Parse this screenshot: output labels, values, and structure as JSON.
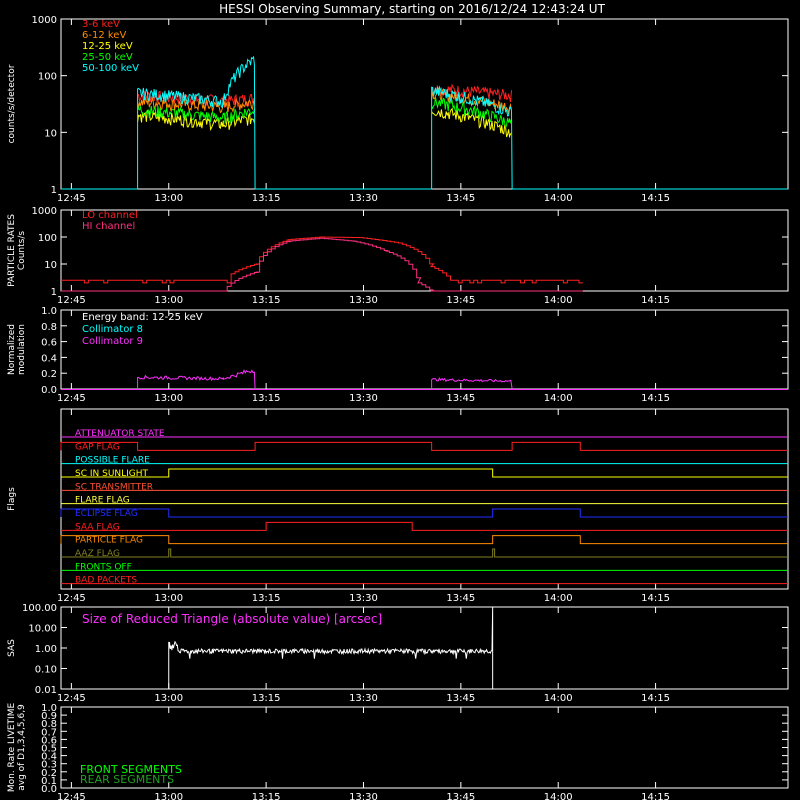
{
  "title": "HESSI Observing Summary, starting on 2016/12/24 12:43:24 UT",
  "time_ticks": [
    "12:45",
    "13:00",
    "13:15",
    "13:30",
    "13:45",
    "14:00",
    "14:15"
  ],
  "colors": {
    "3-6": "#ff2020",
    "6-12": "#ff8c00",
    "12-25": "#ffff00",
    "25-50": "#00ff00",
    "50-100": "#00ffff",
    "lo": "#ff2020",
    "hi": "#ff3080",
    "white": "#ffffff",
    "magenta": "#ff30ff"
  },
  "chart_data": [
    {
      "type": "line",
      "ylabel": "counts/s/detector",
      "ylim": [
        1,
        1000
      ],
      "yscale": "log",
      "yticks": [
        "1",
        "10",
        "100",
        "1000"
      ],
      "x_unit": "minutes from 12:43:24",
      "series": [
        {
          "name": "3-6 keV",
          "color": "#ff2020",
          "segments": [
            [
              [
                11.8,
                45
              ],
              [
                25,
                36
              ],
              [
                29.9,
                40
              ]
            ],
            [
              [
                57.1,
                60
              ],
              [
                69.5,
                45
              ]
            ]
          ]
        },
        {
          "name": "6-12 keV",
          "color": "#ff8c00",
          "segments": [
            [
              [
                11.8,
                35
              ],
              [
                25,
                28
              ],
              [
                29.9,
                35
              ]
            ],
            [
              [
                57.1,
                50
              ],
              [
                69.5,
                27
              ]
            ]
          ]
        },
        {
          "name": "12-25 keV",
          "color": "#ffff00",
          "segments": [
            [
              [
                11.8,
                20
              ],
              [
                25,
                14
              ],
              [
                29.9,
                18
              ]
            ],
            [
              [
                57.1,
                25
              ],
              [
                69.5,
                10
              ]
            ]
          ]
        },
        {
          "name": "25-50 keV",
          "color": "#00ff00",
          "segments": [
            [
              [
                11.8,
                25
              ],
              [
                25,
                18
              ],
              [
                29.9,
                25
              ]
            ],
            [
              [
                57.1,
                35
              ],
              [
                69.5,
                14
              ]
            ]
          ]
        },
        {
          "name": "50-100 keV",
          "color": "#00ffff",
          "segments": [
            [
              [
                11.8,
                50
              ],
              [
                25,
                35
              ],
              [
                29.9,
                200
              ]
            ],
            [
              [
                57.1,
                55
              ],
              [
                69.5,
                22
              ]
            ]
          ]
        }
      ]
    },
    {
      "type": "line",
      "ylabel": "PARTICLE RATES\nCounts/s",
      "ylim": [
        1,
        1000
      ],
      "yscale": "log",
      "yticks": [
        "1",
        "10",
        "100",
        "1000"
      ],
      "series": [
        {
          "name": "LO channel",
          "color": "#ff2020",
          "points": [
            [
              0,
              2.5
            ],
            [
              25,
              2.5
            ],
            [
              30,
              10
            ],
            [
              35,
              80
            ],
            [
              40,
              100
            ],
            [
              46,
              95
            ],
            [
              52,
              60
            ],
            [
              57,
              8
            ],
            [
              60,
              2.5
            ],
            [
              80,
              2.5
            ]
          ]
        },
        {
          "name": "HI channel",
          "color": "#ff3080",
          "points": [
            [
              0,
              1
            ],
            [
              25,
              1
            ],
            [
              30,
              5
            ],
            [
              35,
              70
            ],
            [
              40,
              90
            ],
            [
              45,
              70
            ],
            [
              50,
              30
            ],
            [
              55,
              2
            ],
            [
              57,
              1
            ],
            [
              80,
              1
            ]
          ]
        }
      ]
    },
    {
      "type": "line",
      "ylabel": "Normalized\nmodulation",
      "ylim": [
        0,
        1
      ],
      "yticks": [
        "0.0",
        "0.2",
        "0.4",
        "0.6",
        "0.8",
        "1.0"
      ],
      "annotation": "Energy band: 12-25 keV",
      "series": [
        {
          "name": "Collimator 8",
          "color": "#00ffff",
          "points": []
        },
        {
          "name": "Collimator 9",
          "color": "#ff30ff",
          "segments": [
            [
              [
                11.8,
                0.15
              ],
              [
                25,
                0.13
              ],
              [
                29.9,
                0.25
              ]
            ],
            [
              [
                57.1,
                0.12
              ],
              [
                69.5,
                0.1
              ]
            ]
          ]
        }
      ]
    },
    {
      "type": "line",
      "ylabel": "Flags",
      "flags": [
        {
          "name": "ATTENUATOR STATE",
          "color": "#ff30ff",
          "on_intervals": []
        },
        {
          "name": "GAP FLAG",
          "color": "#ff2020",
          "on_intervals": [
            [
              0,
              11.8
            ],
            [
              29.9,
              57.1
            ],
            [
              69.5,
              80
            ]
          ]
        },
        {
          "name": "POSSIBLE FLARE",
          "color": "#00ffff",
          "on_intervals": []
        },
        {
          "name": "SC IN SUNLIGHT",
          "color": "#ffff00",
          "on_intervals": [
            [
              16.6,
              66.5
            ]
          ]
        },
        {
          "name": "SC TRANSMITTER",
          "color": "#ff5030",
          "on_intervals": []
        },
        {
          "name": "FLARE FLAG",
          "color": "#ffff40",
          "on_intervals": []
        },
        {
          "name": "ECLIPSE FLAG",
          "color": "#2030ff",
          "on_intervals": [
            [
              0,
              16.6
            ],
            [
              66.5,
              80
            ]
          ]
        },
        {
          "name": "SAA FLAG",
          "color": "#ff2020",
          "on_intervals": [
            [
              31.6,
              54.1
            ]
          ]
        },
        {
          "name": "PARTICLE FLAG",
          "color": "#ff8c00",
          "on_intervals": [
            [
              0,
              16.6
            ],
            [
              66.5,
              80
            ]
          ]
        },
        {
          "name": "AAZ FLAG",
          "color": "#808020",
          "on_intervals": [
            [
              16.6,
              16.9
            ],
            [
              66.5,
              66.8
            ]
          ]
        },
        {
          "name": "FRONTS OFF",
          "color": "#00ff00",
          "on_intervals": []
        },
        {
          "name": "BAD PACKETS",
          "color": "#ff2020",
          "on_intervals": []
        }
      ]
    },
    {
      "type": "line",
      "ylabel": "SAS",
      "ylim": [
        0.01,
        100
      ],
      "yscale": "log",
      "yticks": [
        "0.01",
        "0.10",
        "1.00",
        "10.00",
        "100.00"
      ],
      "annotation": "Size of Reduced Triangle (absolute value) [arcsec]",
      "series": [
        {
          "name": "Size of Reduced Triangle",
          "color": "#ffffff",
          "points": [
            [
              16.6,
              0.8
            ],
            [
              20,
              0.65
            ],
            [
              40,
              0.7
            ],
            [
              66.5,
              0.75
            ]
          ]
        }
      ]
    },
    {
      "type": "line",
      "ylabel": "Mon. Rate LIVETIME\navg of D1,3,4,5,6,9",
      "ylim": [
        0,
        1
      ],
      "yticks": [
        "0.0",
        "0.1",
        "0.2",
        "0.3",
        "0.4",
        "0.5",
        "0.6",
        "0.7",
        "0.8",
        "0.9",
        "1.0"
      ],
      "series": [
        {
          "name": "FRONT SEGMENTS",
          "color": "#00ff00",
          "points": []
        },
        {
          "name": "REAR SEGMENTS",
          "color": "#20a020",
          "points": []
        }
      ]
    }
  ]
}
